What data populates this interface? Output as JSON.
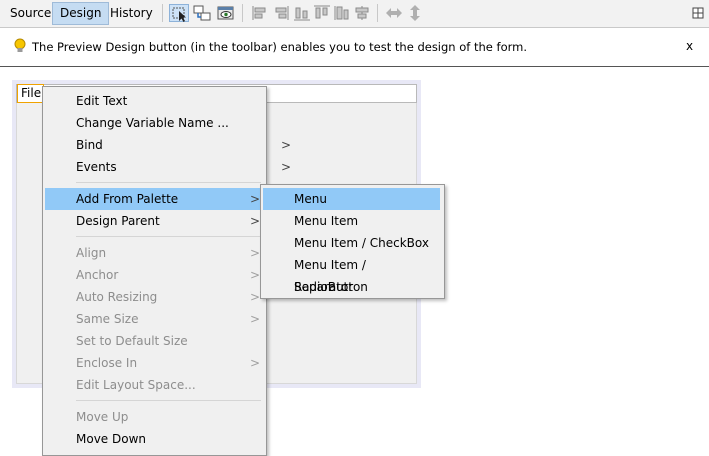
{
  "toolbar": {
    "tabs": [
      {
        "label": "Source"
      },
      {
        "label": "Design"
      },
      {
        "label": "History"
      }
    ],
    "icons": [
      "selection-mode-icon",
      "connection-mode-icon",
      "preview-design-icon",
      "align-left-icon",
      "align-right-icon",
      "center-horizontal-icon",
      "align-top-icon",
      "align-bottom-icon",
      "center-vertical-icon",
      "resize-horizontal-icon",
      "resize-vertical-icon",
      "maximize-icon"
    ]
  },
  "info_bar": {
    "message": "The Preview Design button (in the toolbar) enables you to test the design of the form.",
    "close": "x"
  },
  "form": {
    "menu_label": "File"
  },
  "context_menu": {
    "items": [
      {
        "label": "Edit Text"
      },
      {
        "label": "Change Variable Name ..."
      },
      {
        "label": "Bind",
        "submenu": ">"
      },
      {
        "label": "Events",
        "submenu": ">"
      },
      {
        "label": "Add From Palette",
        "submenu": ">",
        "highlighted": true
      },
      {
        "label": "Design Parent",
        "submenu": ">"
      },
      {
        "label": "Align",
        "submenu": ">",
        "disabled": true
      },
      {
        "label": "Anchor",
        "submenu": ">",
        "disabled": true
      },
      {
        "label": "Auto Resizing",
        "submenu": ">",
        "disabled": true
      },
      {
        "label": "Same Size",
        "submenu": ">",
        "disabled": true
      },
      {
        "label": "Set to Default Size",
        "disabled": true
      },
      {
        "label": "Enclose In",
        "submenu": ">",
        "disabled": true
      },
      {
        "label": "Edit Layout Space...",
        "disabled": true
      },
      {
        "label": "Move Up",
        "disabled": true
      },
      {
        "label": "Move Down"
      }
    ]
  },
  "submenu": {
    "items": [
      {
        "label": "Menu",
        "highlighted": true
      },
      {
        "label": "Menu Item"
      },
      {
        "label": "Menu Item / CheckBox"
      },
      {
        "label": "Menu Item / RadioButton"
      },
      {
        "label": "Separator"
      }
    ]
  },
  "colors": {
    "highlight": "#91c9f7",
    "active_tab": "#c5dcf2",
    "selection_border": "#f0a300"
  }
}
